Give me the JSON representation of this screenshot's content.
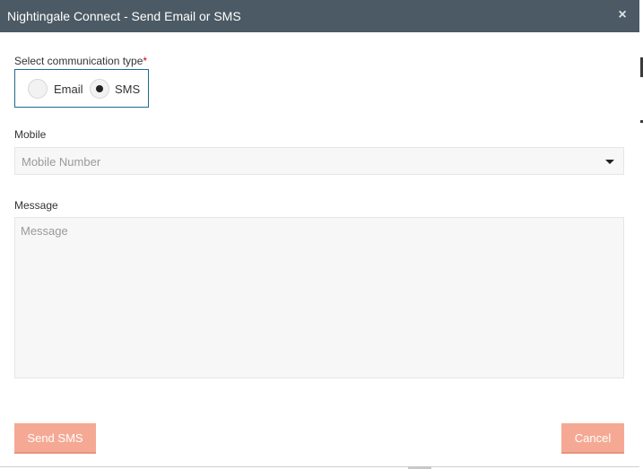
{
  "dialog": {
    "title": "Nightingale Connect - Send Email or SMS",
    "close_icon": "close-icon",
    "close_glyph": "×"
  },
  "communication": {
    "label": "Select communication type",
    "required_marker": "*",
    "options": [
      {
        "label": "Email",
        "selected": false
      },
      {
        "label": "SMS",
        "selected": true
      }
    ]
  },
  "mobile": {
    "label": "Mobile",
    "placeholder": "Mobile Number",
    "caret_icon": "caret-down-icon"
  },
  "message": {
    "label": "Message",
    "placeholder": "Message",
    "value": ""
  },
  "buttons": {
    "send_label": "Send SMS",
    "cancel_label": "Cancel"
  },
  "colors": {
    "titlebar": "#4b5a64",
    "button": "#f5a994",
    "radio_group_border": "#1f6b8f",
    "required": "#d0021b"
  }
}
